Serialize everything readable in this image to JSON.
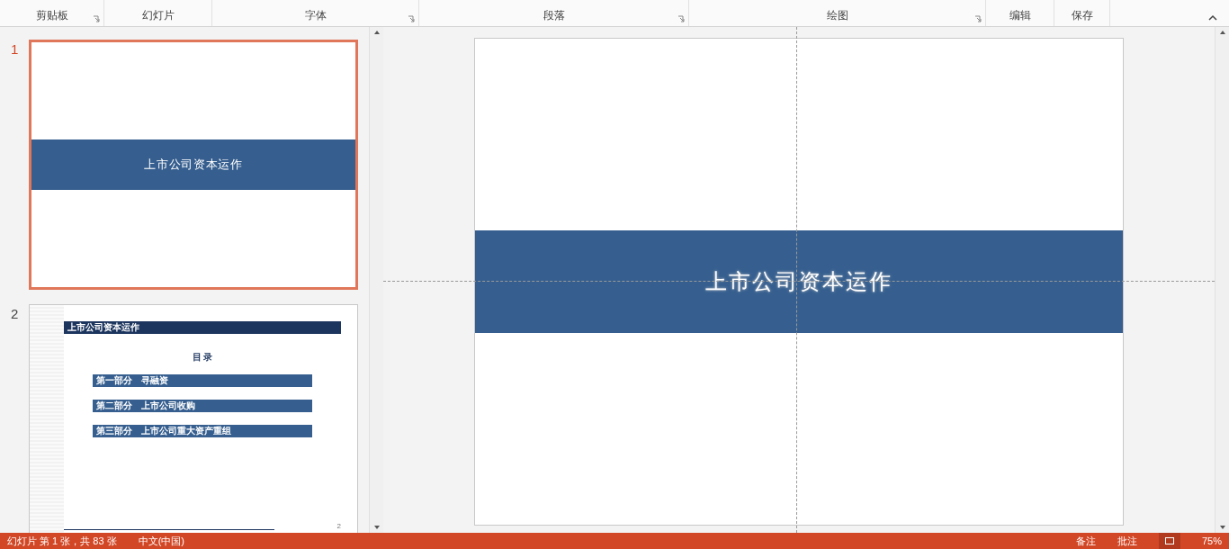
{
  "ribbon_groups": [
    {
      "label": "剪贴板",
      "launcher": true
    },
    {
      "label": "幻灯片",
      "launcher": false
    },
    {
      "label": "字体",
      "launcher": true
    },
    {
      "label": "段落",
      "launcher": true
    },
    {
      "label": "绘图",
      "launcher": true
    },
    {
      "label": "编辑",
      "launcher": false
    },
    {
      "label": "保存",
      "launcher": false
    }
  ],
  "thumbnails": [
    {
      "number": "1",
      "selected": true,
      "kind": "title",
      "title": "上市公司资本运作"
    },
    {
      "number": "2",
      "selected": false,
      "kind": "contents",
      "header": "上市公司资本运作",
      "heading": "目 录",
      "items": [
        "第一部分　寻融资",
        "第二部分　上市公司收购",
        "第三部分　上市公司重大资产重组"
      ],
      "page": "2"
    }
  ],
  "slide": {
    "title": "上市公司资本运作"
  },
  "status_bar": {
    "slide_info": "幻灯片 第 1 张，共 83 张",
    "language": "中文(中国)",
    "notes": "备注",
    "comments": "批注",
    "zoom": "75%"
  }
}
